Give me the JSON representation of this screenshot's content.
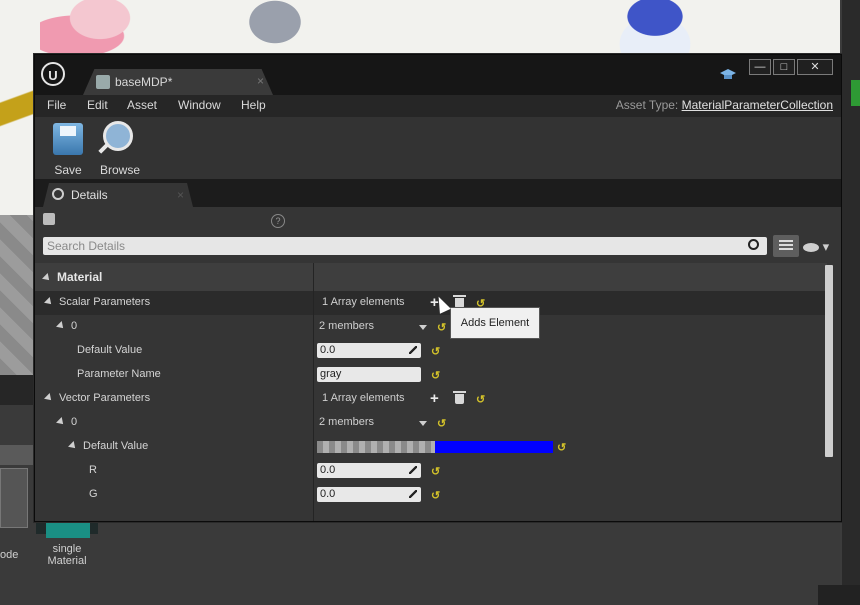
{
  "background": {
    "thumb_label_left": "ode",
    "thumb_label_right": "single\nMaterial"
  },
  "window": {
    "tab_title": "baseMDP*",
    "controls": {
      "minimize": "—",
      "maximize": "□",
      "close": "✕"
    }
  },
  "menu": {
    "items": [
      "File",
      "Edit",
      "Asset",
      "Window",
      "Help"
    ],
    "asset_type_label": "Asset Type:",
    "asset_type_value": "MaterialParameterCollection"
  },
  "toolbar": {
    "save_label": "Save",
    "browse_label": "Browse"
  },
  "details_tab": {
    "label": "Details",
    "close": "×"
  },
  "search": {
    "placeholder": "Search Details"
  },
  "category": {
    "label": "Material"
  },
  "rows": {
    "scalar_params": {
      "label": "Scalar Parameters",
      "value": "1 Array elements"
    },
    "scalar_0": {
      "label": "0",
      "value": "2 members"
    },
    "scalar_default": {
      "label": "Default Value",
      "value": "0.0"
    },
    "scalar_name": {
      "label": "Parameter Name",
      "value": "gray"
    },
    "vector_params": {
      "label": "Vector Parameters",
      "value": "1 Array elements"
    },
    "vector_0": {
      "label": "0",
      "value": "2 members"
    },
    "vector_default": {
      "label": "Default Value",
      "color": "#0000ff"
    },
    "r": {
      "label": "R",
      "value": "0.0"
    },
    "g": {
      "label": "G",
      "value": "0.0"
    }
  },
  "tooltip": {
    "text": "Adds Element"
  },
  "colors": {
    "accent_reset": "#d2c12a",
    "swatch": "#0000ff"
  }
}
